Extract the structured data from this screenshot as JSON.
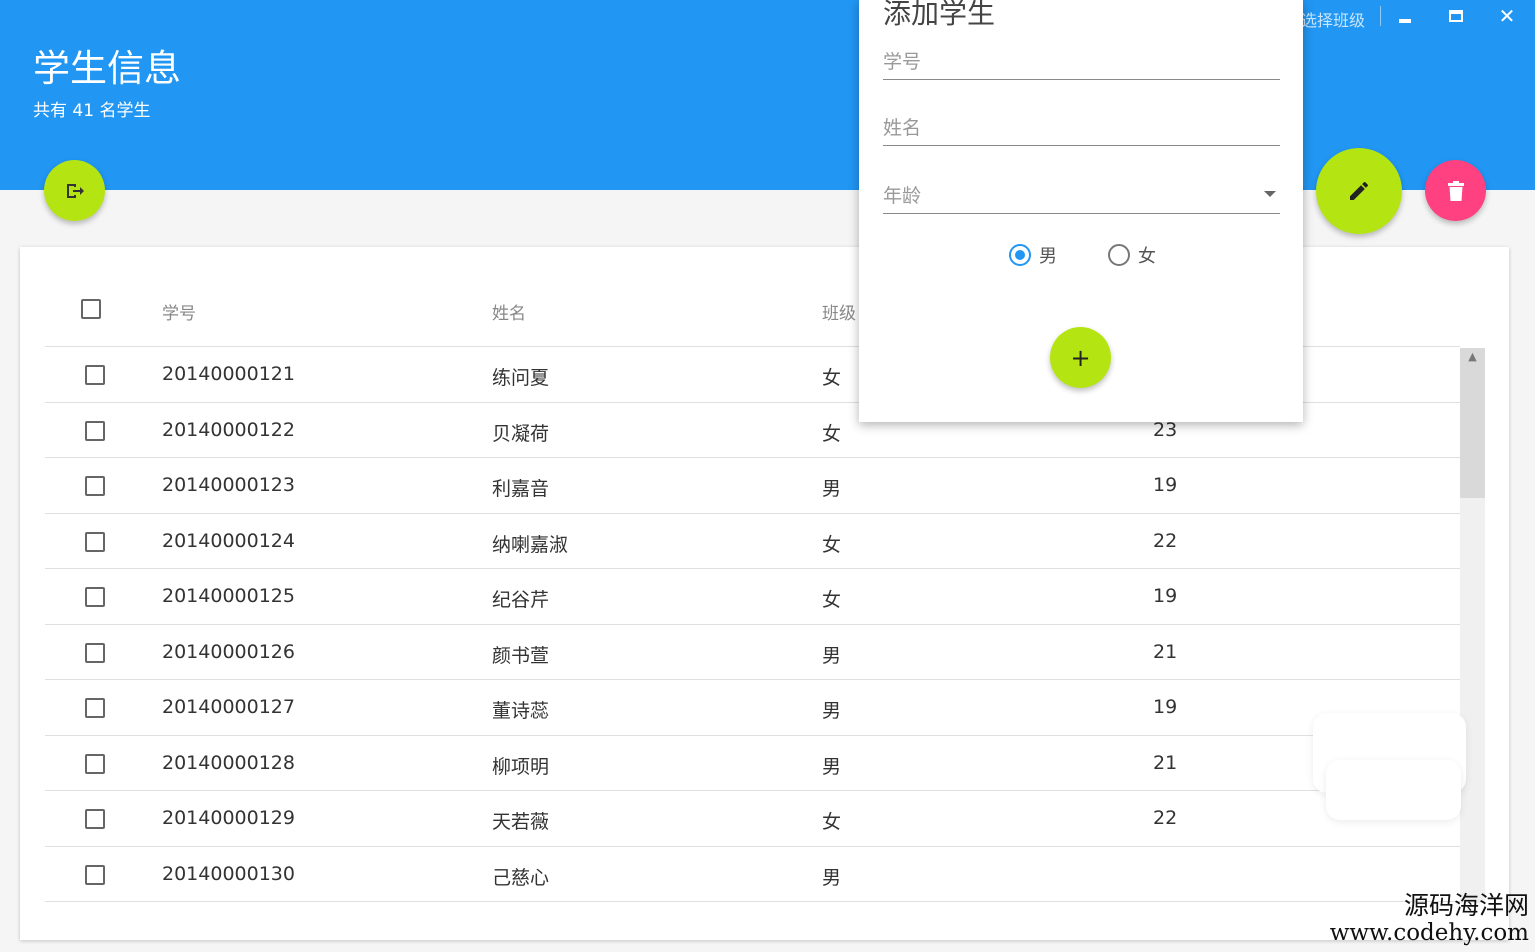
{
  "header": {
    "title": "学生信息",
    "subtitle": "共有  41  名学生",
    "select_class": "选择班级"
  },
  "window_controls": {
    "close_glyph": "✕"
  },
  "table": {
    "columns": [
      "学号",
      "姓名",
      "班级"
    ],
    "rows": [
      {
        "id": "20140000121",
        "name": "练问夏",
        "gender": "女",
        "age": ""
      },
      {
        "id": "20140000122",
        "name": "贝凝荷",
        "gender": "女",
        "age": "23"
      },
      {
        "id": "20140000123",
        "name": "利嘉音",
        "gender": "男",
        "age": "19"
      },
      {
        "id": "20140000124",
        "name": "纳喇嘉淑",
        "gender": "女",
        "age": "22"
      },
      {
        "id": "20140000125",
        "name": "纪谷芹",
        "gender": "女",
        "age": "19"
      },
      {
        "id": "20140000126",
        "name": "颜书萱",
        "gender": "男",
        "age": "21"
      },
      {
        "id": "20140000127",
        "name": "董诗蕊",
        "gender": "男",
        "age": "19"
      },
      {
        "id": "20140000128",
        "name": "柳项明",
        "gender": "男",
        "age": "21"
      },
      {
        "id": "20140000129",
        "name": "天若薇",
        "gender": "女",
        "age": "22"
      },
      {
        "id": "20140000130",
        "name": "己慈心",
        "gender": "男",
        "age": ""
      }
    ]
  },
  "dialog": {
    "title": "添加学生",
    "id_placeholder": "学号",
    "name_placeholder": "姓名",
    "age_placeholder": "年龄",
    "gender_male": "男",
    "gender_female": "女",
    "selected_gender": "男",
    "add_glyph": "+"
  },
  "colors": {
    "header": "#2196f3",
    "fab_lime": "#b4e513",
    "fab_pink": "#ff4081"
  },
  "icons": {
    "logout": "logout-icon",
    "edit": "pencil-icon",
    "delete": "trash-icon",
    "add": "plus-icon"
  },
  "watermark": {
    "line1": "源码海洋网",
    "line2": "www.codehy.com"
  }
}
